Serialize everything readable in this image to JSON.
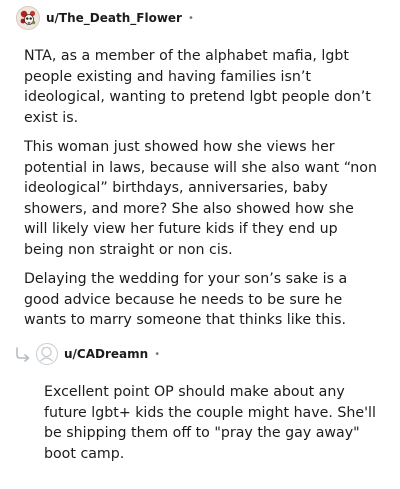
{
  "comments": [
    {
      "username": "u/The_Death_Flower",
      "separator": "•",
      "avatar_icon": "flower-skull-avatar-icon",
      "paragraphs": [
        "NTA, as a member of the alphabet mafia, lgbt people existing and having families isn’t ideological, wanting to pretend lgbt people don’t exist is.",
        "This woman just showed how she views her potential in laws, because will she also want “non ideological” birthdays, anniversaries, baby showers, and more? She also showed how she will likely view her future kids if they end up being non straight or non cis.",
        "Delaying the wedding for your son’s sake is a good advice because he needs to be sure he wants to marry someone that thinks like this."
      ]
    },
    {
      "username": "u/CADreamn",
      "separator": "•",
      "avatar_icon": "default-user-avatar-icon",
      "reply_icon": "reply-arrow-icon",
      "paragraphs": [
        "Excellent point OP should make about any future lgbt+ kids the couple might have. She'll be shipping them off to \"pray the gay away\" boot camp."
      ]
    }
  ]
}
